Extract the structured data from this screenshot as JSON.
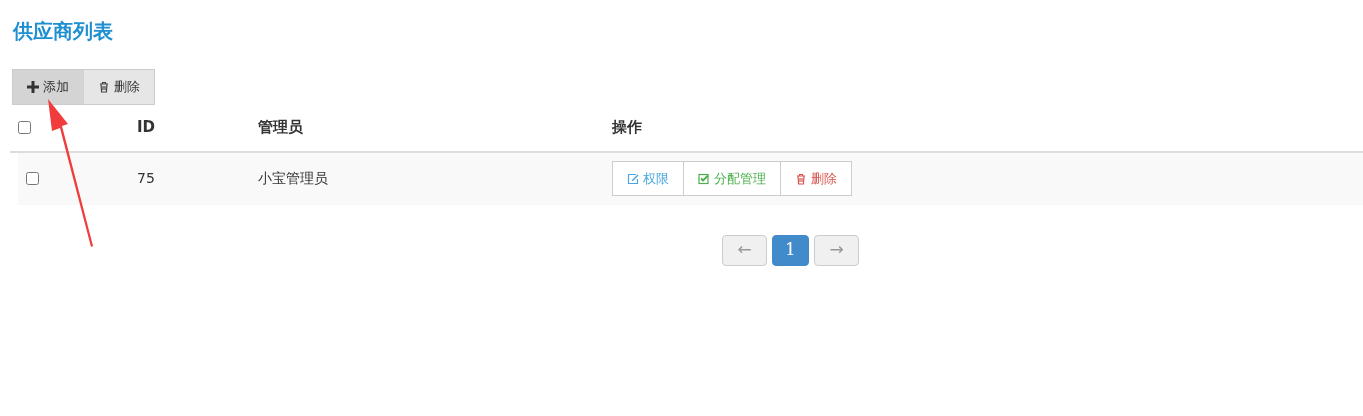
{
  "title": "供应商列表",
  "toolbar": [
    {
      "kind": "add",
      "label": "添加",
      "active": true
    },
    {
      "kind": "delete",
      "label": "删除",
      "active": false
    }
  ],
  "table": {
    "select_all": {
      "checked": false
    },
    "columns": [
      "ID",
      "管理员",
      "操作"
    ],
    "rows": [
      {
        "checked": false,
        "id": "75",
        "name": "小宝管理员",
        "actions": [
          {
            "kind": "edit",
            "label": "权限"
          },
          {
            "kind": "assign",
            "label": "分配管理"
          },
          {
            "kind": "delete",
            "label": "删除"
          }
        ]
      }
    ]
  },
  "pagination": {
    "prev": {
      "label": "←",
      "disabled": true
    },
    "pages": [
      {
        "label": "1",
        "selected": true
      }
    ],
    "next": {
      "label": "→",
      "disabled": true
    }
  }
}
